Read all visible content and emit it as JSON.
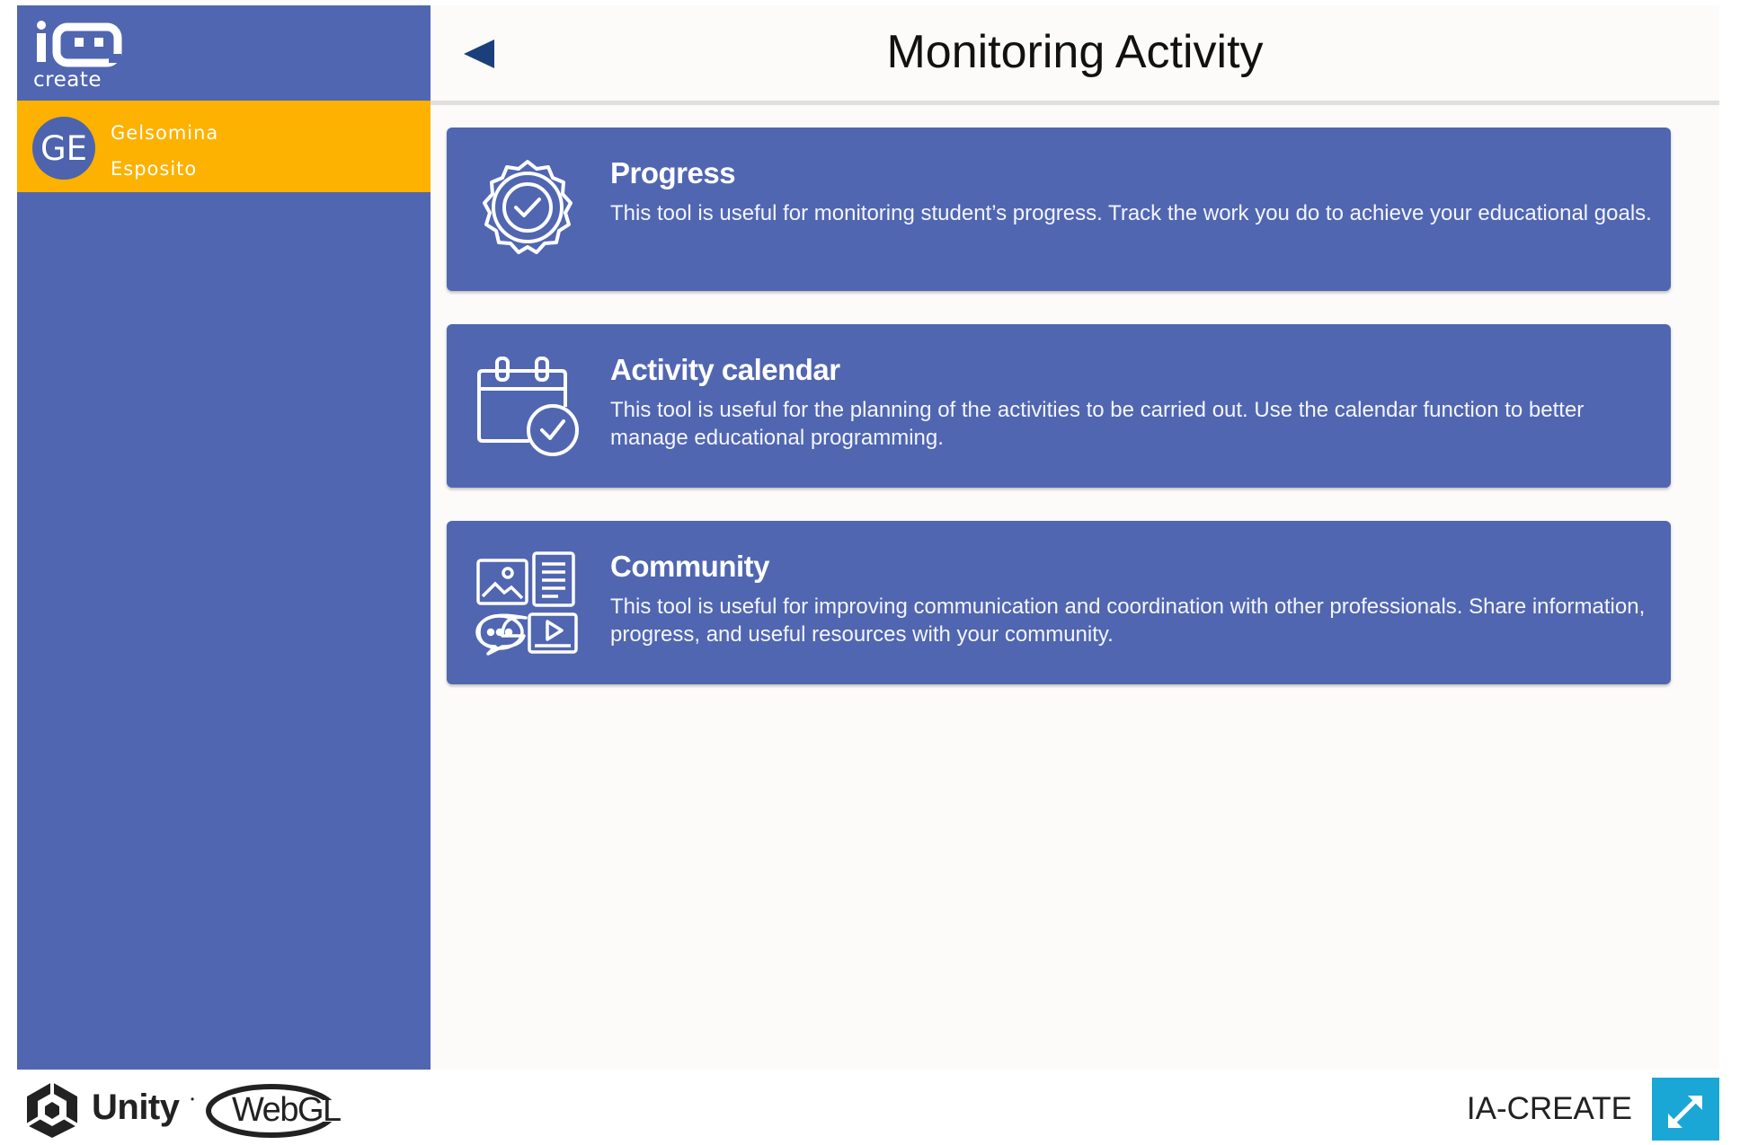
{
  "sidebar": {
    "logo_text": "create",
    "user": {
      "initials": "GE",
      "first_name": "Gelsomina",
      "last_name": "Esposito"
    }
  },
  "header": {
    "title": "Monitoring Activity",
    "back_icon": "back-arrow-icon"
  },
  "cards": [
    {
      "title": "Progress",
      "description": "This tool is useful for monitoring student’s progress. Track the work you do to achieve your educational goals.",
      "icon": "badge-check-icon"
    },
    {
      "title": "Activity calendar",
      "description": "This tool is useful for the planning of the activities to be carried out. Use the calendar function to better manage educational programming.",
      "icon": "calendar-check-icon"
    },
    {
      "title": "Community",
      "description": "This tool is useful for improving communication and coordination with other professionals. Share information, progress, and useful resources with your community.",
      "icon": "community-media-icon"
    }
  ],
  "footer": {
    "unity_label": "Unity",
    "webgl_label": "WebGL",
    "brand": "IA-CREATE",
    "fullscreen_icon": "fullscreen-icon"
  },
  "colors": {
    "primary": "#5066b1",
    "accent": "#fdb100",
    "fullscreen": "#1aa7d6",
    "background": "#fcfbf9"
  }
}
